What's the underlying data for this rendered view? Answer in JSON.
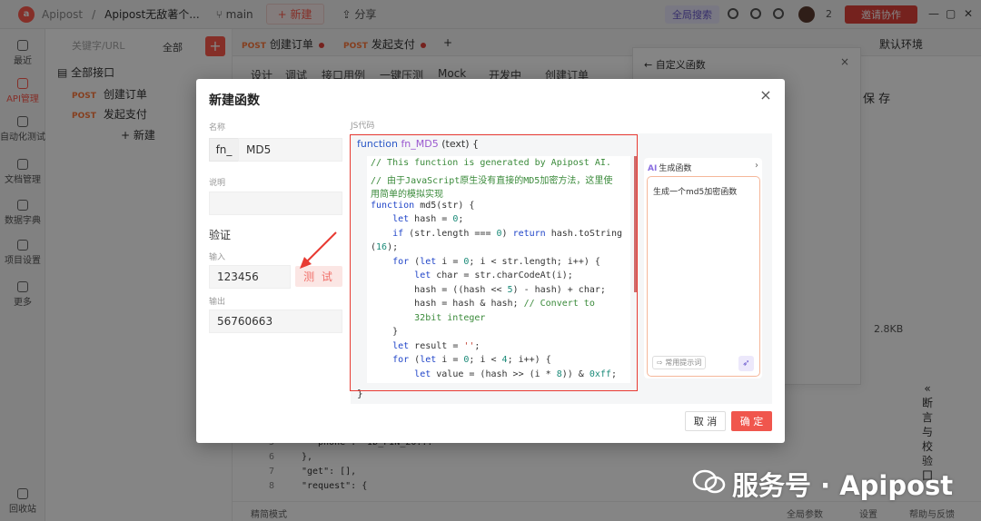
{
  "topbar": {
    "app_name": "Apipost",
    "project": "Apipost无敌著个...",
    "branch": "main",
    "new_label": "+ 新建",
    "share_label": "分享",
    "search_label": "全局搜索",
    "member_count": "2",
    "invite_label": "邀请协作"
  },
  "leftnav": {
    "items": [
      "最近",
      "API管理",
      "自动化测试",
      "文档管理",
      "数据字典",
      "项目设置",
      "更多"
    ],
    "recycle": "回收站"
  },
  "tree": {
    "search_placeholder": "关键字/URL",
    "filter": "全部",
    "add": "+",
    "root": "全部接口",
    "items": [
      {
        "method": "POST",
        "name": "创建订单"
      },
      {
        "method": "POST",
        "name": "发起支付"
      }
    ],
    "new_label": "+ 新建"
  },
  "tabs": [
    {
      "method": "POST",
      "name": "创建订单"
    },
    {
      "method": "POST",
      "name": "发起支付"
    }
  ],
  "env_label": "默认环境",
  "subtabs": [
    "设计",
    "调试",
    "接口用例",
    "一键压测",
    "Mock",
    "开发中",
    "创建订单"
  ],
  "side_panel": {
    "title": "自定义函数",
    "close": "×"
  },
  "save_label": "保 存",
  "size_info": "2.8KB",
  "right_rail": [
    "«",
    "断",
    "言",
    "与",
    "校",
    "验",
    "囗"
  ],
  "bg_code": [
    {
      "ln": "5",
      "text": "\"phone\": \"ID_PIN_20... \""
    },
    {
      "ln": "6",
      "text": "},"
    },
    {
      "ln": "7",
      "text": "\"get\": [],"
    },
    {
      "ln": "8",
      "text": "\"request\": {"
    }
  ],
  "status_bar": [
    "精简模式",
    "全局参数",
    "设置",
    "帮助与反馈"
  ],
  "watermark": "服务号 · Apipost",
  "modal": {
    "title": "新建函数",
    "close": "×",
    "name_label": "名称",
    "name_prefix": "fn_",
    "name_value": "MD5",
    "desc_label": "说明",
    "desc_value": "",
    "verify_title": "验证",
    "input_label": "输入",
    "input_value": "123456",
    "test_label": "测 试",
    "output_label": "输出",
    "output_value": "56760663",
    "js_label": "JS代码",
    "fn_keyword": "function",
    "fn_name": "fn_MD5",
    "fn_args": " (text) {",
    "close_brace": "}",
    "cancel": "取 消",
    "ok": "确 定"
  },
  "code_lines": [
    "// This function is generated by Apipost AI.",
    "// 由于JavaScript原生没有直接的MD5加密方法，这里使",
    "用简单的模拟实现",
    "function md5(str) {",
    "    let hash = 0;",
    "    if (str.length === 0) return hash.toString",
    "(16);",
    "    for (let i = 0; i < str.length; i++) {",
    "        let char = str.charCodeAt(i);",
    "        hash = ((hash << 5) - hash) + char;",
    "        hash = hash & hash; // Convert to",
    "        32bit integer",
    "    }",
    "    let result = '';",
    "    for (let i = 0; i < 4; i++) {",
    "        let value = (hash >> (i * 8)) & 0xff;"
  ],
  "ai_panel": {
    "title": "生成函数",
    "chevron": "›",
    "prompt": "生成一个md5加密函数",
    "hint": "⇨ 常用提示词",
    "send": "➶"
  }
}
